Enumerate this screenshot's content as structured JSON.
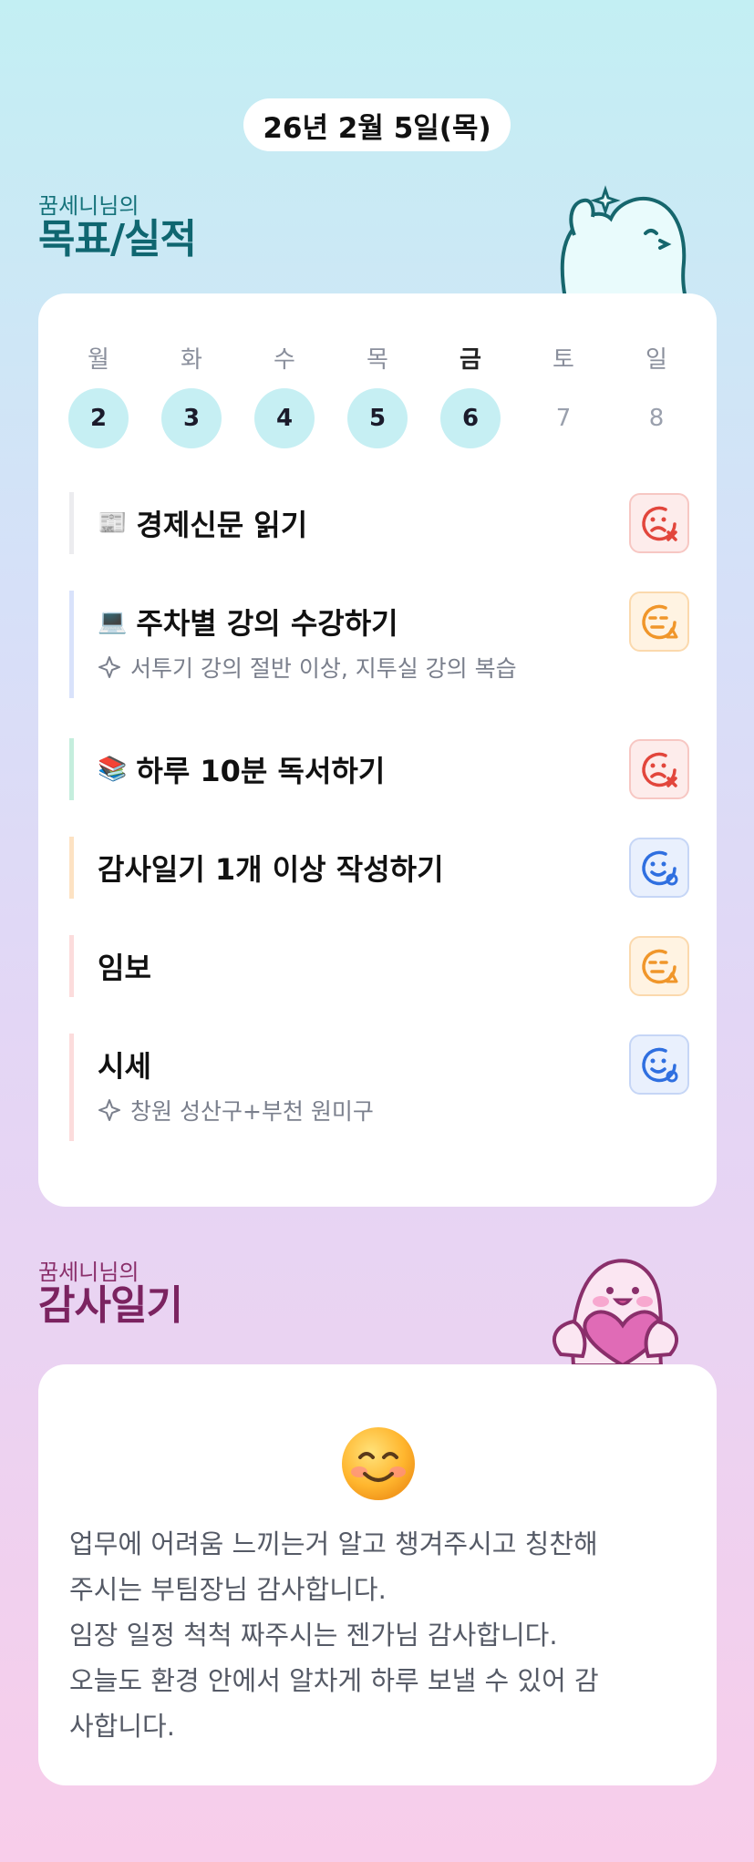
{
  "date": "26년 2월 5일(목)",
  "goals_section": {
    "small": "꿈세니님의",
    "big": "목표/실적"
  },
  "thanks_section": {
    "small": "꿈세니님의",
    "big": "감사일기"
  },
  "week": {
    "labels": [
      "월",
      "화",
      "수",
      "목",
      "금",
      "토",
      "일"
    ],
    "numbers": [
      "2",
      "3",
      "4",
      "5",
      "6",
      "7",
      "8"
    ]
  },
  "goals": [
    {
      "title": "경제신문 읽기",
      "emoji": "📰",
      "status": "red",
      "sub": ""
    },
    {
      "title": "주차별 강의 수강하기",
      "emoji": "💻",
      "status": "orange",
      "sub": "서투기 강의 절반 이상, 지투실 강의 복습"
    },
    {
      "title": "하루 10분 독서하기",
      "emoji": "📚",
      "status": "red",
      "sub": ""
    },
    {
      "title": "감사일기 1개 이상 작성하기",
      "emoji": "",
      "status": "blue",
      "sub": ""
    },
    {
      "title": "임보",
      "emoji": "",
      "status": "orange",
      "sub": ""
    },
    {
      "title": "시세",
      "emoji": "",
      "status": "blue",
      "sub": "창원 성산구+부천 원미구"
    }
  ],
  "thanks": {
    "lines": [
      "업무에 어려움 느끼는거 알고 챙겨주시고 칭찬해",
      "주시는 부팀장님 감사합니다.",
      "임장 일정 척척 짜주시는 젠가님 감사합니다.",
      "오늘도 환경 안에서 알차게 하루 보낼 수 있어 감",
      "사합니다."
    ]
  },
  "colors": {
    "red": "#e2463c",
    "orange": "#f0962a",
    "blue": "#2f6fe0",
    "teal": "#0f6670",
    "plum": "#7b2360"
  }
}
